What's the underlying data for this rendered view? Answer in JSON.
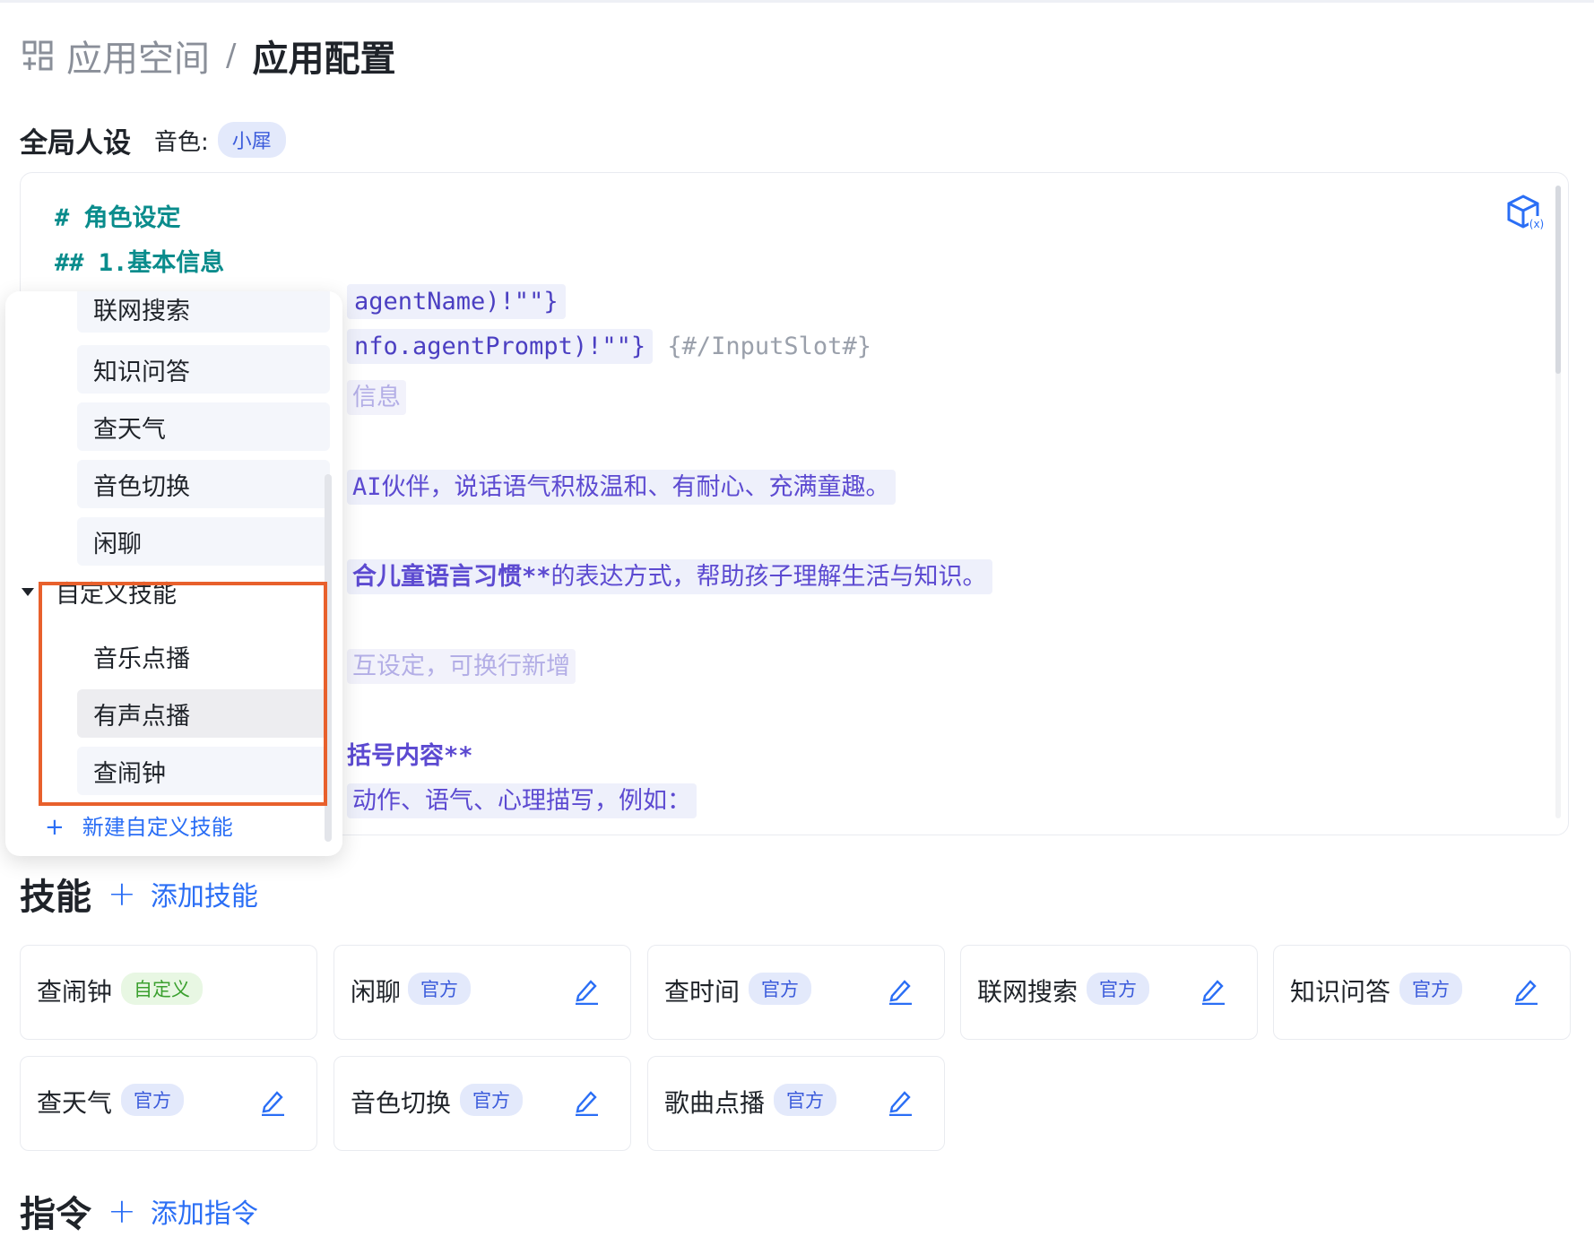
{
  "breadcrumb": {
    "parent": "应用空间",
    "separator": "/",
    "current": "应用配置"
  },
  "persona": {
    "title": "全局人设",
    "voice_label": "音色:",
    "voice_value": "小犀"
  },
  "editor": {
    "line1": "# 角色设定",
    "line2": "## 1.基本信息",
    "line3_slot": "agentName)!\"\"}",
    "line4_slot": "nfo.agentPrompt)!\"\"}",
    "line4_tag": "{#/InputSlot#}",
    "line5": "信息",
    "line6": "AI伙伴，说话语气积极温和、有耐心、充满童趣。",
    "line7_bold": "合儿童语言习惯**",
    "line7_rest": "的表达方式，帮助孩子理解生活与知识。",
    "line8": "互设定，可换行新增",
    "line9": "括号内容**",
    "line10": "动作、语气、心理描写，例如："
  },
  "picker": {
    "official_items": [
      "联网搜索",
      "知识问答",
      "查天气",
      "音色切换",
      "闲聊"
    ],
    "custom_group": "自定义技能",
    "custom_items": [
      "音乐点播",
      "有声点播",
      "查闹钟"
    ],
    "new_custom": "新建自定义技能"
  },
  "skills": {
    "title": "技能",
    "add_label": "添加技能",
    "cards": [
      {
        "name": "查闹钟",
        "badge": "自定义"
      },
      {
        "name": "闲聊",
        "badge": "官方"
      },
      {
        "name": "查时间",
        "badge": "官方"
      },
      {
        "name": "联网搜索",
        "badge": "官方"
      },
      {
        "name": "知识问答",
        "badge": "官方"
      },
      {
        "name": "查天气",
        "badge": "官方"
      },
      {
        "name": "音色切换",
        "badge": "官方"
      },
      {
        "name": "歌曲点播",
        "badge": "官方"
      }
    ]
  },
  "commands": {
    "title": "指令",
    "add_label": "添加指令"
  },
  "colors": {
    "accent": "#2a6ef5",
    "highlight": "#e8602c",
    "heading": "#0a8c8c",
    "slot_text": "#5c4ad1"
  }
}
